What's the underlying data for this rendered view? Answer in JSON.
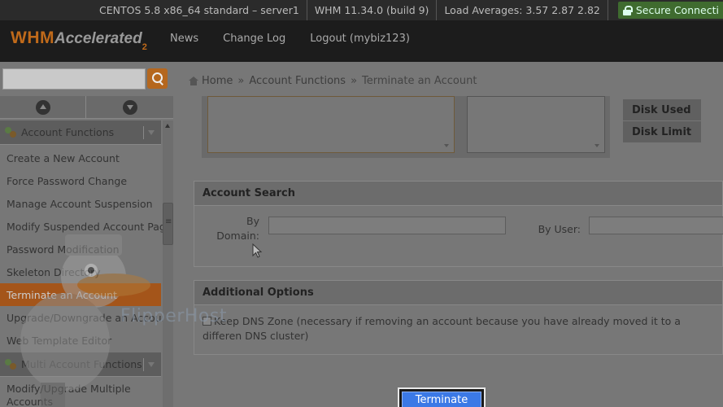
{
  "statusbar": {
    "server": "CENTOS 5.8 x86_64 standard – server1",
    "version": "WHM 11.34.0 (build 9)",
    "load": "Load Averages: 3.57 2.87 2.82",
    "secure": "Secure Connecti"
  },
  "header": {
    "logo_whm": "WHM",
    "logo_accel": "Accelerated",
    "logo_sub": "2",
    "nav": [
      "News",
      "Change Log",
      "Logout (mybiz123)"
    ]
  },
  "breadcrumb": {
    "home": "Home",
    "section": "Account Functions",
    "current": "Terminate an Account",
    "sep": "»"
  },
  "sidebar": {
    "group1": "Account Functions",
    "items": [
      "Create a New Account",
      "Force Password Change",
      "Manage Account Suspension",
      "Modify Suspended Account Page",
      "Password Modification",
      "Skeleton Directory",
      "Terminate an Account",
      "Upgrade/Downgrade an Account",
      "Web Template Editor"
    ],
    "group2": "Multi Account Functions",
    "group2_items": [
      "Modify/Upgrade Multiple Accounts"
    ]
  },
  "main": {
    "disk_used": "Disk Used",
    "disk_limit": "Disk Limit",
    "account_search_title": "Account Search",
    "by_domain_label": "By Domain:",
    "by_user_label": "By User:",
    "options_title": "Additional Options",
    "keep_dns_label": "Keep DNS Zone (necessary if removing an account because you have already moved it to a differen DNS cluster)",
    "terminate_label": "Terminate"
  },
  "watermark": {
    "text": "FlipperHost"
  }
}
